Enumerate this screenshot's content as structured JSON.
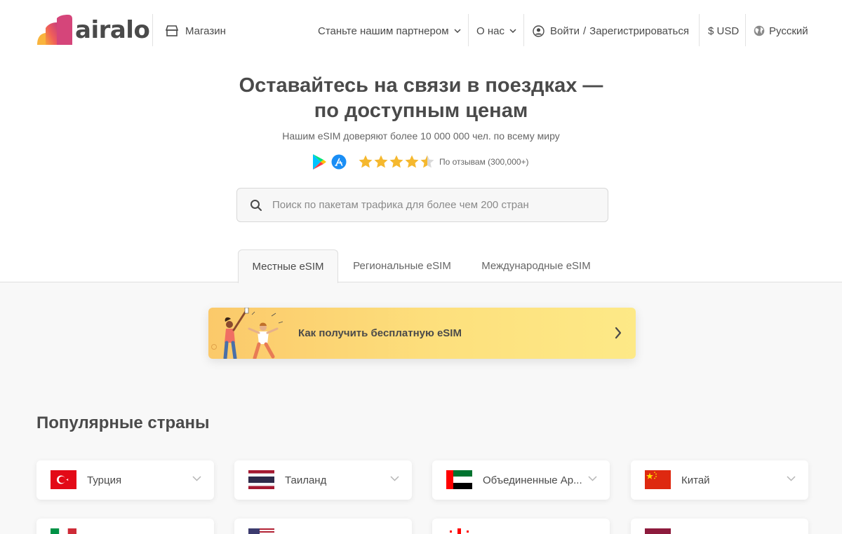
{
  "header": {
    "logo_text": "airalo",
    "shop_label": "Магазин",
    "partner_label": "Станьте нашим партнером",
    "about_label": "О нас",
    "login_label": "Войти",
    "login_separator": "/",
    "register_label": "Зарегистрироваться",
    "currency_label": "$ USD",
    "language_label": "Русский"
  },
  "hero": {
    "title_line1": "Оставайтесь на связи в поездках —",
    "title_line2": "по доступным ценам",
    "subtitle": "Нашим eSIM доверяют более 10 000 000 чел. по всему миру",
    "rating_value": 4.5,
    "rating_max": 5,
    "rating_text": "По отзывам (300,000+)"
  },
  "search": {
    "placeholder": "Поиск по пакетам трафика для более чем 200 стран"
  },
  "tabs": [
    {
      "label": "Местные eSIM",
      "active": true
    },
    {
      "label": "Региональные eSIM",
      "active": false
    },
    {
      "label": "Международные eSIM",
      "active": false
    }
  ],
  "promo": {
    "label": "Как получить бесплатную eSIM"
  },
  "popular": {
    "title": "Популярные страны",
    "countries": [
      {
        "name": "Турция"
      },
      {
        "name": "Таиланд"
      },
      {
        "name": "Объединенные Ар..."
      },
      {
        "name": "Китай"
      }
    ]
  },
  "colors": {
    "text": "#4a4a4a",
    "star": "#f5b82e",
    "promo_start": "#fbc96a",
    "promo_end": "#fde987"
  }
}
